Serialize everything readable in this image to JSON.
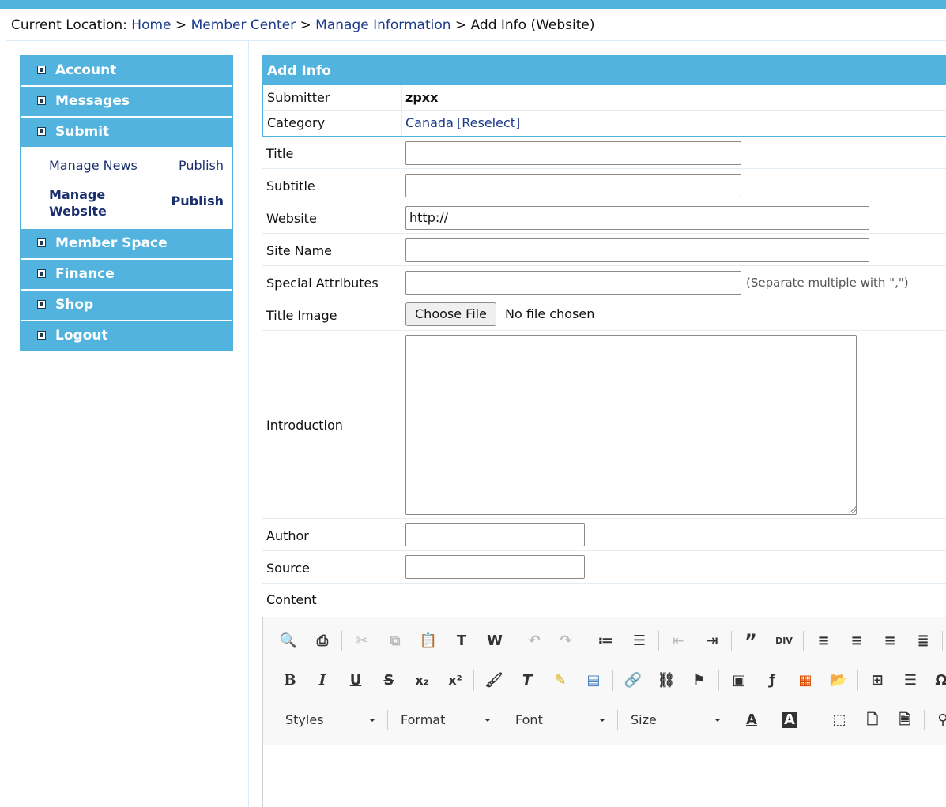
{
  "breadcrumb": {
    "prefix": "Current Location: ",
    "home": "Home",
    "member_center": "Member Center",
    "manage_info": "Manage Information",
    "current": "Add Info (Website)",
    "sep": " > "
  },
  "sidebar": {
    "items": [
      {
        "label": "Account"
      },
      {
        "label": "Messages"
      },
      {
        "label": "Submit"
      },
      {
        "label": "Member Space"
      },
      {
        "label": "Finance"
      },
      {
        "label": "Shop"
      },
      {
        "label": "Logout"
      }
    ],
    "submit_sub": {
      "manage_news": "Manage News",
      "publish_news": "Publish",
      "manage_website": "Manage Website",
      "publish_website": "Publish"
    }
  },
  "form": {
    "header": "Add Info",
    "submitter_label": "Submitter",
    "submitter_value": "zpxx",
    "category_label": "Category",
    "category_value": "Canada",
    "reselect": "[Reselect]",
    "title_label": "Title",
    "title_value": "",
    "subtitle_label": "Subtitle",
    "subtitle_value": "",
    "website_label": "Website",
    "website_value": "http://",
    "sitename_label": "Site Name",
    "sitename_value": "",
    "special_label": "Special Attributes",
    "special_value": "",
    "special_hint": "(Separate multiple with \",\")",
    "image_label": "Title Image",
    "choose_file": "Choose File",
    "no_file": "No file chosen",
    "intro_label": "Introduction",
    "intro_value": "",
    "author_label": "Author",
    "author_value": "",
    "source_label": "Source",
    "source_value": "",
    "content_label": "Content"
  },
  "editor": {
    "styles": "Styles",
    "format": "Format",
    "font": "Font",
    "size": "Size"
  }
}
